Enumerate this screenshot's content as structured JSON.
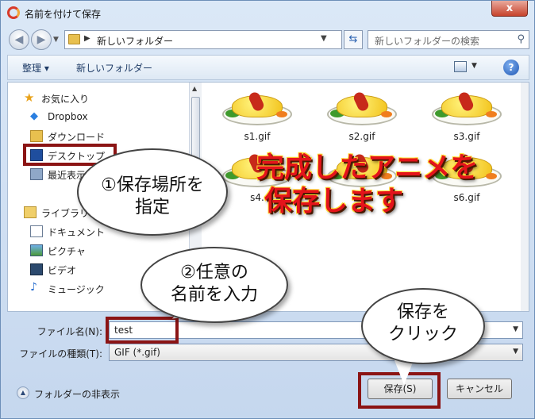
{
  "window": {
    "title": "名前を付けて保存",
    "close_glyph": "x"
  },
  "address": {
    "path_text": "新しいフォルダー",
    "search_placeholder": "新しいフォルダーの検索"
  },
  "toolbar": {
    "organize_label": "整理 ▾",
    "new_folder_label": "新しいフォルダー"
  },
  "nav": {
    "items": [
      {
        "label": "お気に入り",
        "icon": "star-icon"
      },
      {
        "label": "Dropbox",
        "icon": "dropbox-icon"
      },
      {
        "label": "ダウンロード",
        "icon": "download-icon"
      },
      {
        "label": "デスクトップ",
        "icon": "desktop-icon"
      },
      {
        "label": "最近表示した",
        "icon": "recent-icon"
      },
      {
        "label": "ライブラリ",
        "icon": "library-icon"
      },
      {
        "label": "ドキュメント",
        "icon": "document-icon"
      },
      {
        "label": "ピクチャ",
        "icon": "picture-icon"
      },
      {
        "label": "ビデオ",
        "icon": "video-icon"
      },
      {
        "label": "ミュージック",
        "icon": "music-icon"
      }
    ]
  },
  "files": [
    {
      "name": "s1.gif"
    },
    {
      "name": "s2.gif"
    },
    {
      "name": "s3.gif"
    },
    {
      "name": "s4."
    },
    {
      "name": "s"
    },
    {
      "name": "s6.gif"
    }
  ],
  "form": {
    "filename_label": "ファイル名(N):",
    "filename_value": "test",
    "filetype_label": "ファイルの種類(T):",
    "filetype_value": "GIF (*.gif)"
  },
  "footer": {
    "hide_folders_label": "フォルダーの非表示",
    "save_label": "保存(S)",
    "cancel_label": "キャンセル"
  },
  "annotations": {
    "bubble1_line1": "①保存場所を",
    "bubble1_line2": "指定",
    "bubble2_line1": "②任意の",
    "bubble2_line2": "名前を入力",
    "bubble3_line1": "保存を",
    "bubble3_line2": "クリック",
    "caption_line1": "完成したアニメを",
    "caption_line2": "保存します"
  },
  "colors": {
    "highlight_box": "#8b1414",
    "caption_red": "#e4141b"
  }
}
